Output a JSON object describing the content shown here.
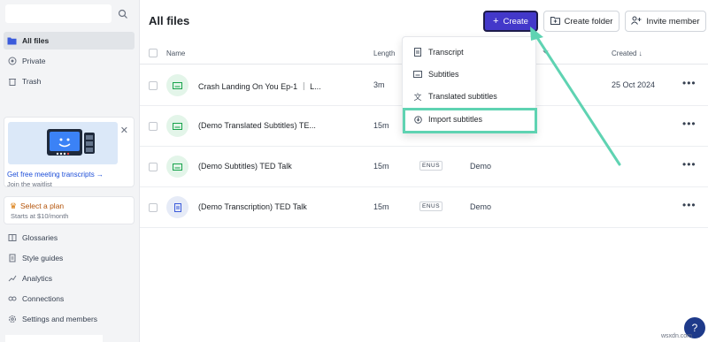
{
  "sidebar": {
    "nav": [
      {
        "label": "All files",
        "icon": "folder-icon"
      },
      {
        "label": "Private",
        "icon": "eye-icon"
      },
      {
        "label": "Trash",
        "icon": "trash-icon"
      }
    ],
    "promo": {
      "link": "Get free meeting transcripts →",
      "sub": "Join the waitlist"
    },
    "plan": {
      "title": "Select a plan",
      "sub": "Starts at $10/month"
    },
    "bottom": [
      {
        "label": "Glossaries",
        "icon": "book-icon"
      },
      {
        "label": "Style guides",
        "icon": "document-icon"
      },
      {
        "label": "Analytics",
        "icon": "chart-icon"
      },
      {
        "label": "Connections",
        "icon": "link-icon"
      },
      {
        "label": "Settings and members",
        "icon": "gear-icon"
      }
    ]
  },
  "header": {
    "title": "All files",
    "create": "Create",
    "create_folder": "Create folder",
    "invite": "Invite member"
  },
  "table": {
    "columns": {
      "name": "Name",
      "length": "Length",
      "created": "Created ↓"
    },
    "rows": [
      {
        "name": "Crash Landing On You Ep-1 ｜ L...",
        "length": "3m",
        "lang": "",
        "tag": "",
        "created": "25 Oct 2024",
        "icon": "subtitles-icon"
      },
      {
        "name": "(Demo Translated Subtitles) TE...",
        "length": "15m",
        "lang": "",
        "tag": "",
        "created": "",
        "icon": "subtitles-icon"
      },
      {
        "name": "(Demo Subtitles) TED Talk",
        "length": "15m",
        "lang": "ENUS",
        "tag": "Demo",
        "created": "",
        "icon": "subtitles-icon"
      },
      {
        "name": "(Demo Transcription) TED Talk",
        "length": "15m",
        "lang": "ENUS",
        "tag": "Demo",
        "created": "",
        "icon": "transcript-icon"
      }
    ]
  },
  "dropdown": {
    "items": [
      {
        "label": "Transcript",
        "icon": "transcript-icon"
      },
      {
        "label": "Subtitles",
        "icon": "subtitles-icon"
      },
      {
        "label": "Translated subtitles",
        "icon": "translate-icon"
      },
      {
        "label": "Import subtitles",
        "icon": "import-icon"
      }
    ]
  },
  "watermark": "wsxdn.com",
  "colors": {
    "accent": "#4338ca",
    "highlight": "#5fd3b2"
  }
}
